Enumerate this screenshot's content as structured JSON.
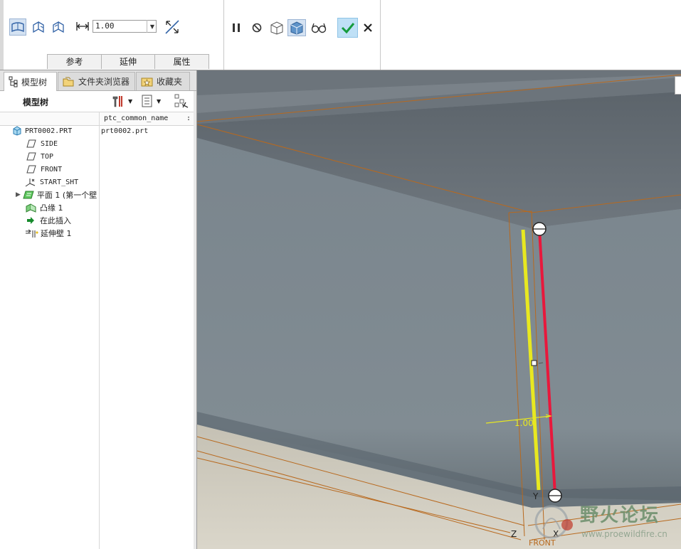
{
  "dashboard": {
    "depth_value": "1.00",
    "tabs": [
      "参考",
      "延伸",
      "属性"
    ],
    "icons": {
      "surface_mode": "surface-icon",
      "side_one": "side-one-icon",
      "side_two": "side-two-icon",
      "depth": "depth-icon",
      "flip": "flip-direction-icon",
      "pause": "pause-icon",
      "no_preview": "no-preview-icon",
      "preview_geometry": "preview-geometry-icon",
      "preview_feature": "preview-feature-icon",
      "verify": "glasses-icon",
      "ok": "check-icon",
      "cancel": "close-icon"
    }
  },
  "navigator": {
    "tabs": [
      {
        "label": "模型树",
        "icon": "model-tree-icon"
      },
      {
        "label": "文件夹浏览器",
        "icon": "folder-browser-icon"
      },
      {
        "label": "收藏夹",
        "icon": "favorites-icon"
      }
    ],
    "tree_title": "模型树",
    "column_header": "ptc_common_name",
    "column_header_more": ":",
    "items": [
      {
        "label": "PRT0002.PRT",
        "icon": "part-icon",
        "common_name": "prt0002.prt"
      },
      {
        "label": "SIDE",
        "icon": "datum-plane-icon"
      },
      {
        "label": "TOP",
        "icon": "datum-plane-icon"
      },
      {
        "label": "FRONT",
        "icon": "datum-plane-icon"
      },
      {
        "label": "START_SHT",
        "icon": "coordinate-system-icon"
      },
      {
        "label": "平面 1 (第一个壁",
        "icon": "sheetmetal-wall-icon"
      },
      {
        "label": "凸缘 1",
        "icon": "flange-icon"
      },
      {
        "label": "在此插入",
        "icon": "insert-here-arrow-icon"
      },
      {
        "label": "延伸壁 1",
        "icon": "extend-wall-icon"
      }
    ]
  },
  "viewport": {
    "dimension_value": "1.00",
    "axis_labels": {
      "y": "Y",
      "z": "Z",
      "x": "X"
    },
    "plane_label": "FRONT",
    "watermark_title": "野火论坛",
    "watermark_url": "www.proewildfire.cn",
    "colors": {
      "yellow_edge": "#e8e820",
      "red_edge": "#e8183c",
      "datum": "#b8691e"
    }
  }
}
